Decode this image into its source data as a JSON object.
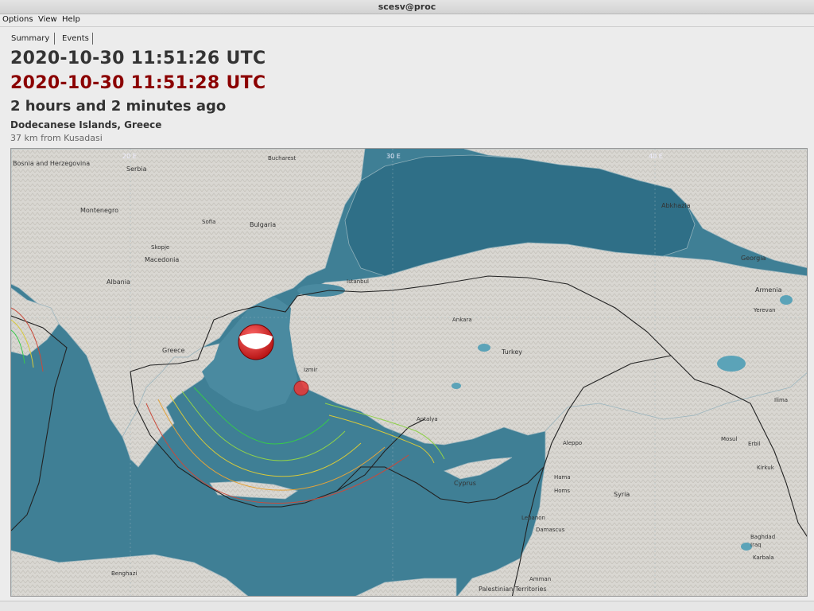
{
  "window": {
    "title": "scesv@proc"
  },
  "menu": [
    {
      "label": "Options"
    },
    {
      "label": "View"
    },
    {
      "label": "Help"
    }
  ],
  "tabs": [
    {
      "label": "Summary",
      "active": true
    },
    {
      "label": "Events",
      "active": false
    }
  ],
  "summary": {
    "origin_time": "2020-10-30 11:51:26 UTC",
    "alt_time": "2020-10-30 11:51:28 UTC",
    "elapsed": "2 hours and 2 minutes ago",
    "region": "Dodecanese Islands, Greece",
    "nearest_city": "37 km from Kusadasi"
  },
  "colors": {
    "origin_time": "#333333",
    "alt_time": "#8b0000",
    "sea": "#3d7c92",
    "land": "#d6d4cf",
    "beachball": "#d11b1b"
  },
  "map": {
    "grid_labels": [
      "20 E",
      "30 E",
      "40 E"
    ],
    "places": {
      "bosnia": "Bosnia and Herzegovina",
      "serbia": "Serbia",
      "bucharest": "Bucharest",
      "montenegro": "Montenegro",
      "sofia": "Sofia",
      "bulgaria": "Bulgaria",
      "skopje": "Skopje",
      "macedonia": "Macedonia",
      "albania": "Albania",
      "istanbul": "Istanbul",
      "ankara": "Ankara",
      "greece": "Greece",
      "turkey": "Turkey",
      "izmir": "Izmir",
      "antalya": "Antalya",
      "abkhazia": "Abkhazia",
      "georgia": "Georgia",
      "armenia": "Armenia",
      "yerevan": "Yerevan",
      "aleppo": "Aleppo",
      "mosul": "Mosul",
      "erbil": "Erbil",
      "kirkuk": "Kirkuk",
      "cyprus": "Cyprus",
      "hama": "Hama",
      "homs": "Homs",
      "syria": "Syria",
      "lebanon": "Lebanon",
      "damascus": "Damascus",
      "baghdad": "Baghdad",
      "iraq": "Iraq",
      "karbala": "Karbala",
      "ilima": "Ilima",
      "benghazi": "Benghazi",
      "amman": "Amman",
      "palestinian": "Palestinian Territories"
    }
  }
}
